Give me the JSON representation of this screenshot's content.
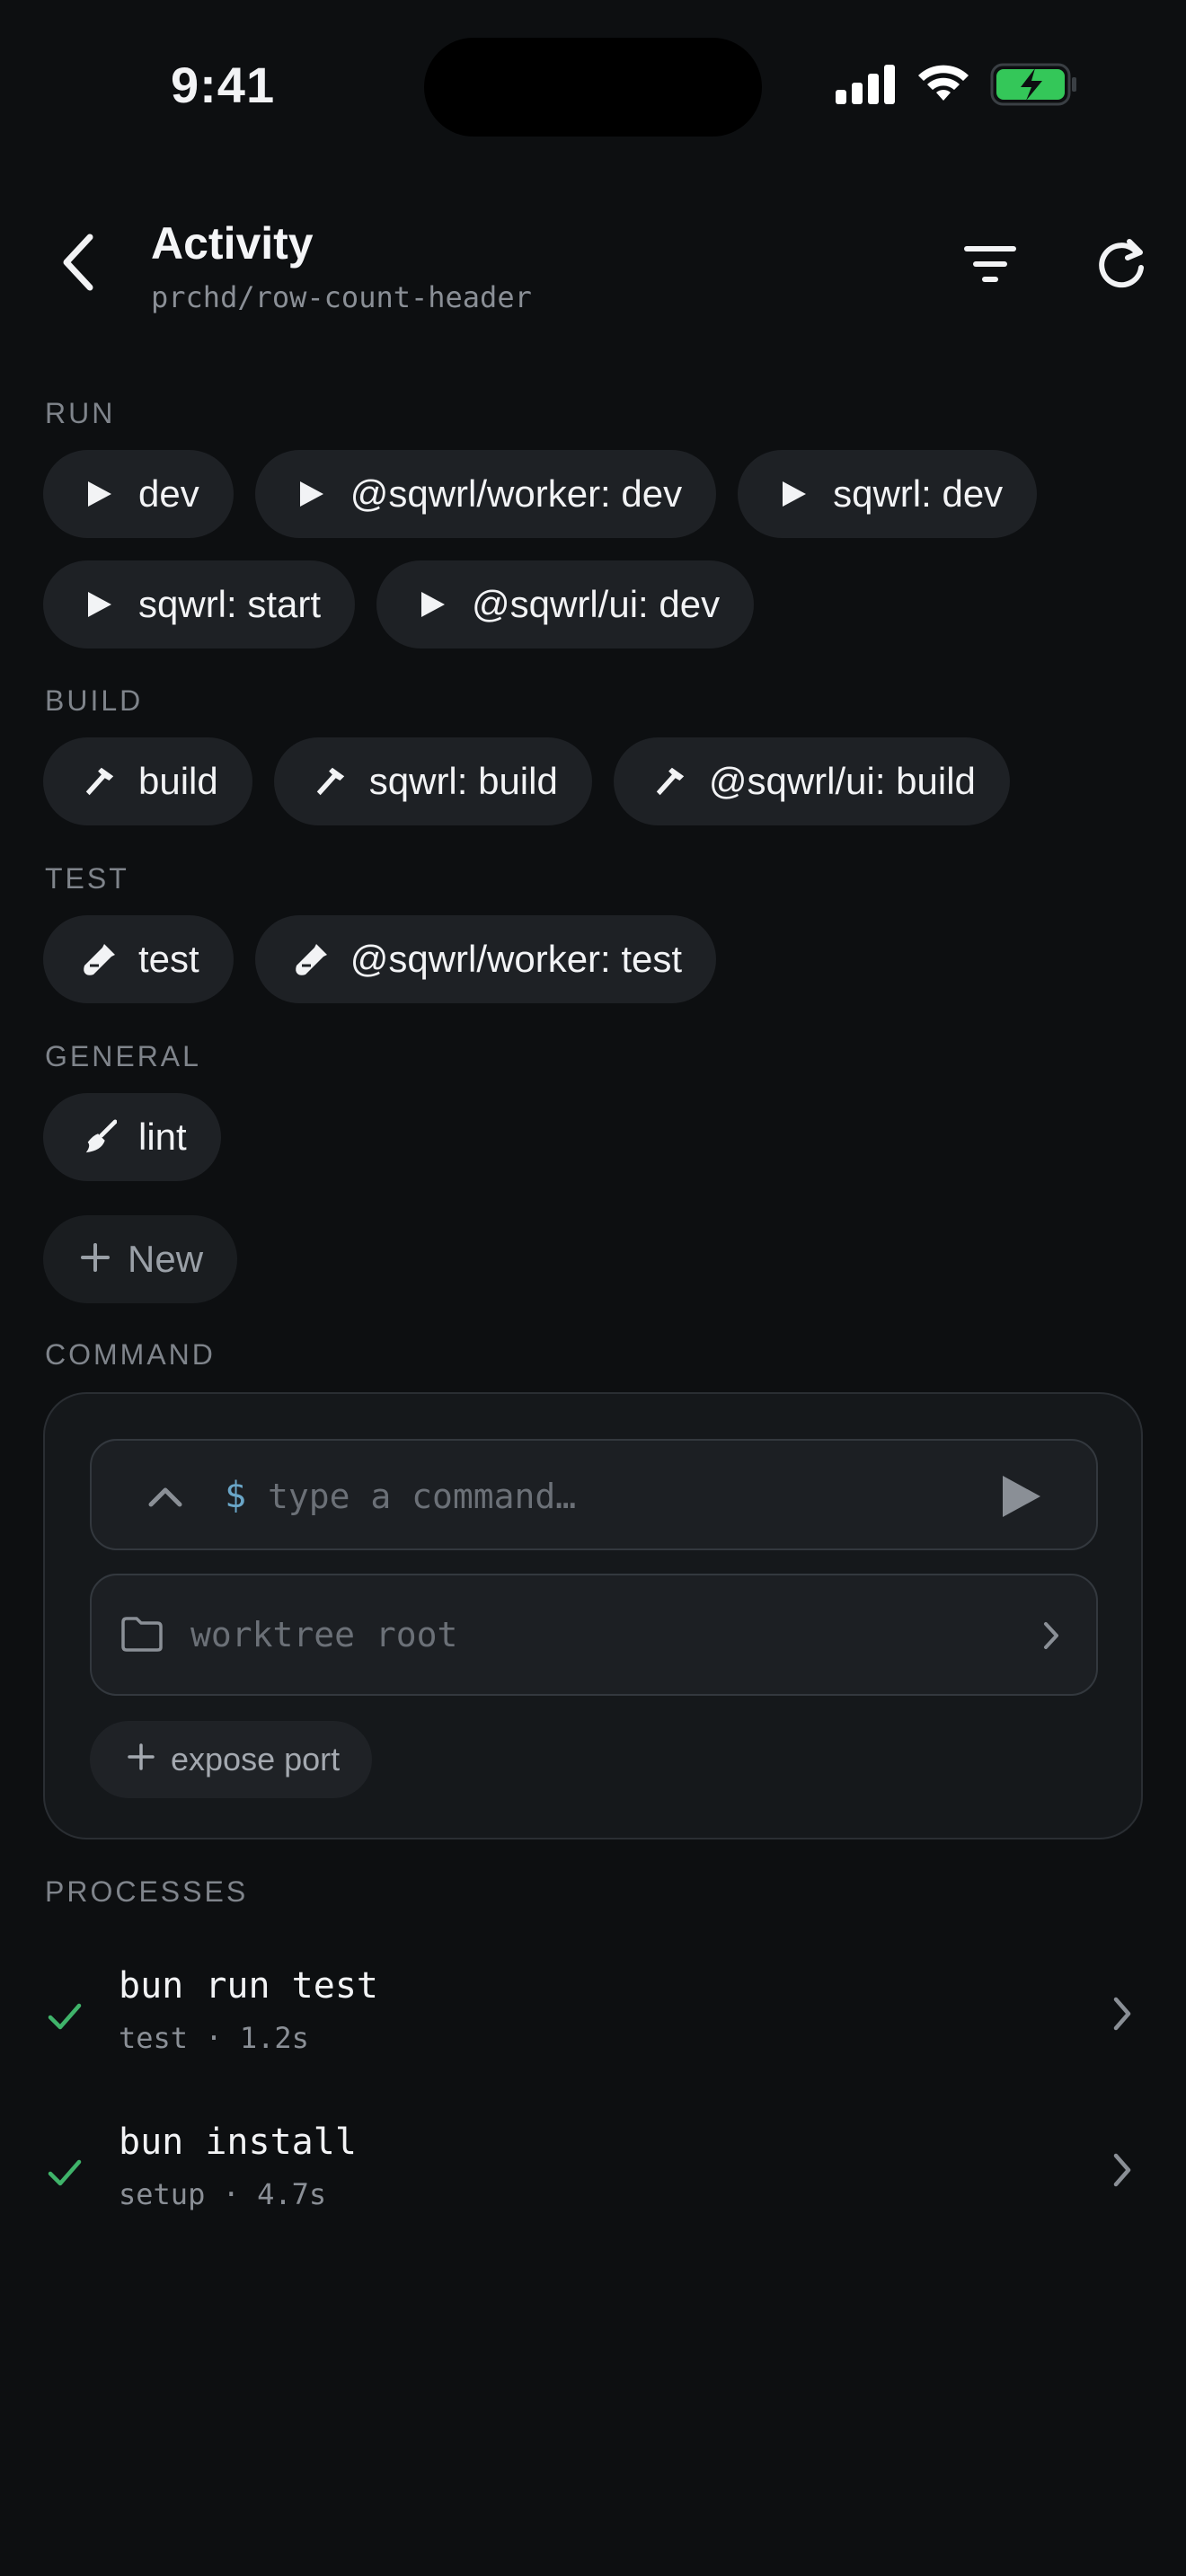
{
  "status_bar": {
    "time": "9:41"
  },
  "header": {
    "title": "Activity",
    "subtitle": "prchd/row-count-header"
  },
  "sections": {
    "run": {
      "label": "RUN",
      "items": [
        "dev",
        "@sqwrl/worker: dev",
        "sqwrl: dev",
        "sqwrl: start",
        "@sqwrl/ui: dev"
      ]
    },
    "build": {
      "label": "BUILD",
      "items": [
        "build",
        "sqwrl: build",
        "@sqwrl/ui: build"
      ]
    },
    "test": {
      "label": "TEST",
      "items": [
        "test",
        "@sqwrl/worker: test"
      ]
    },
    "general": {
      "label": "GENERAL",
      "items": [
        "lint"
      ]
    }
  },
  "new_button": {
    "label": "New"
  },
  "command": {
    "label": "COMMAND",
    "prompt": "$",
    "placeholder": "type a command…",
    "directory": "worktree root",
    "expose_label": "expose port"
  },
  "processes": {
    "label": "PROCESSES",
    "items": [
      {
        "name": "bun run test",
        "meta": "test · 1.2s"
      },
      {
        "name": "bun install",
        "meta": "setup · 4.7s"
      }
    ]
  },
  "colors": {
    "background": "#0d0f11",
    "chip": "#1e2125",
    "success": "#3fb36a",
    "battery": "#34c759",
    "prompt": "#6aa6c8"
  }
}
